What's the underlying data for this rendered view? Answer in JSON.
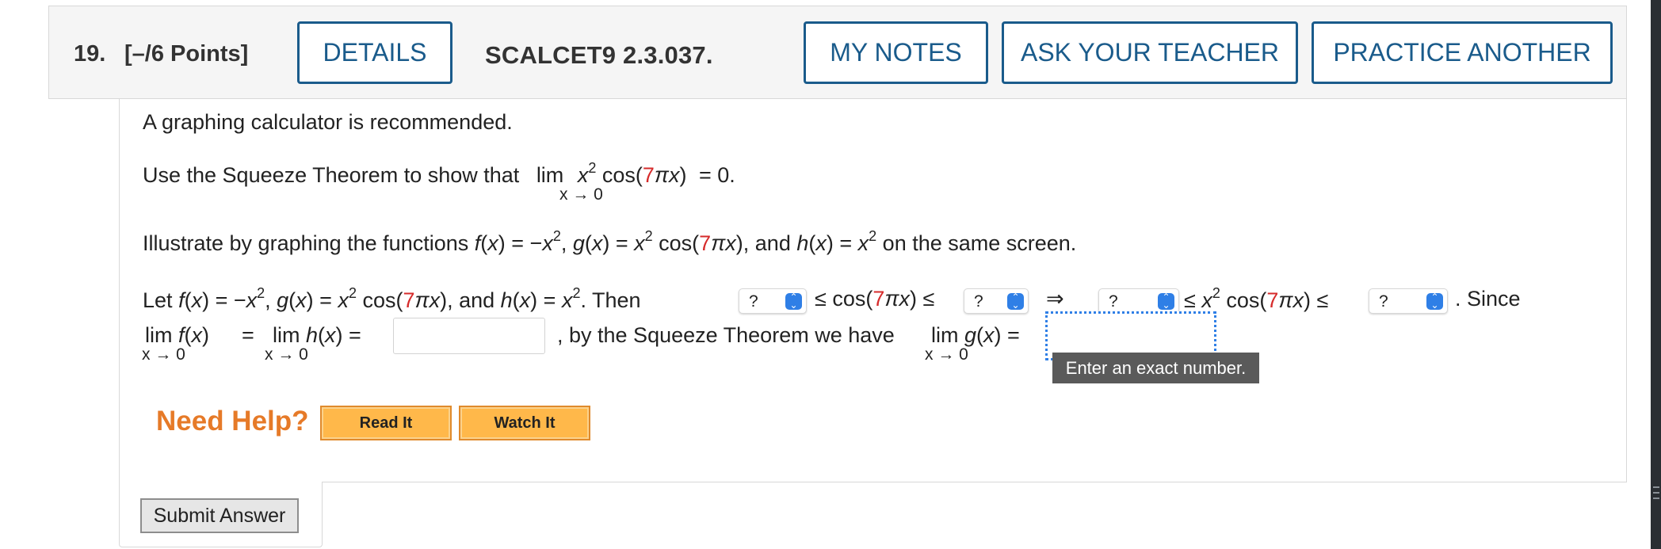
{
  "header": {
    "question_number": "19.",
    "points": "[–/6 Points]",
    "details_label": "DETAILS",
    "course_code": "SCALCET9 2.3.037.",
    "my_notes_label": "MY NOTES",
    "ask_teacher_label": "ASK YOUR TEACHER",
    "practice_another_label": "PRACTICE ANOTHER"
  },
  "problem": {
    "recommendation": "A graphing calculator is recommended.",
    "instruction_prefix": "Use the Squeeze Theorem to show that",
    "illustrate_prefix": "Illustrate by graphing the functions",
    "illustrate_suffix": "on the same screen.",
    "let_prefix": "Let",
    "then_word": ". Then",
    "since_word": ". Since",
    "by_squeeze": ", by the Squeeze Theorem we have",
    "lim_word": "lim",
    "approach": "x → 0",
    "coef": "7",
    "select_placeholder": "?",
    "equals_zero": "= 0."
  },
  "tooltip": {
    "text": "Enter an exact number."
  },
  "help": {
    "need_help": "Need Help?",
    "read_it": "Read It",
    "watch_it": "Watch It"
  },
  "submit": {
    "label": "Submit Answer"
  },
  "colors": {
    "button_border": "#1a5b8b",
    "accent_red": "#d62b2b",
    "need_help": "#e67a28",
    "help_button": "#ffb84a",
    "select_chevron": "#2f7fe6"
  }
}
